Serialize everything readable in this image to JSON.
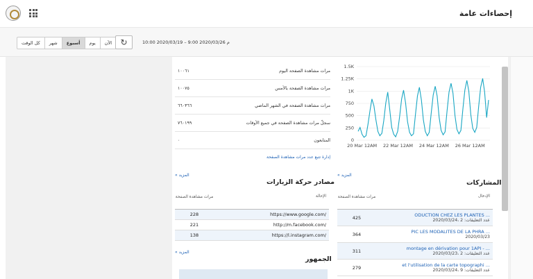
{
  "header": {
    "title": "إحصاءات عامة",
    "logo_icon": "site-logo-icon",
    "apps_icon": "apps-grid-icon"
  },
  "toolbar": {
    "ranges": [
      "كل الوقت",
      "شهر",
      "أسبوع",
      "يوم",
      "الآن"
    ],
    "active_range": "أسبوع",
    "refresh_icon": "refresh-icon",
    "date_range": "10:00 2020/03/19 – 9:00 2020/03/26 م"
  },
  "stats": {
    "rows": [
      {
        "label": "مرات مشاهدة الصفحة اليوم",
        "value": "١٠٠٦١"
      },
      {
        "label": "مرات مشاهدة الصفحة بالأمس",
        "value": "١٠٠٧٥"
      },
      {
        "label": "مرات مشاهدة الصفحة في الشهر الماضي",
        "value": "٦٦٠٣٦٦"
      },
      {
        "label": "سجلّ مرات مشاهدة الصفحة في جميع الأوقات",
        "value": "٧٦٠١٩٩"
      },
      {
        "label": "المتابعون",
        "value": "٠"
      }
    ],
    "link": "إدارة تتبع عدد مرات مشاهدة الصفحة"
  },
  "chart_data": {
    "type": "line",
    "title": "",
    "x": [
      "20 Mar 12AM",
      "22 Mar 12AM",
      "24 Mar 12AM",
      "26 Mar 12AM"
    ],
    "ylim": [
      0,
      1500
    ],
    "yticks": [
      "0",
      "250",
      "500",
      "750",
      "1K",
      "1.25K",
      "1.5K"
    ],
    "series": [
      {
        "values": [
          180,
          260,
          120,
          60,
          90,
          320,
          600,
          840,
          700,
          420,
          180,
          90,
          140,
          400,
          760,
          980,
          620,
          260,
          120,
          70,
          180,
          480,
          840,
          1020,
          760,
          380,
          160,
          90,
          130,
          520,
          900,
          1080,
          820,
          420,
          180,
          90,
          160,
          560,
          920,
          1100,
          900,
          460,
          200,
          110,
          170,
          600,
          980,
          1160,
          960,
          500,
          220,
          130,
          200,
          640,
          1020,
          1220,
          1000,
          520,
          240,
          160,
          260,
          700,
          1080,
          1260,
          980,
          460,
          820
        ]
      }
    ],
    "color": "#18a6c3"
  },
  "links": {
    "more": "المزيد »"
  },
  "traffic": {
    "title": "مصادر حركة الزيارات",
    "col_source": "الإحالة",
    "col_views": "مرات مشاهدة الصفحة",
    "rows": [
      {
        "source": "https://www.google.com/",
        "views": "228"
      },
      {
        "source": "http://m.facebook.com/",
        "views": "221"
      },
      {
        "source": "https://l.instagram.com/",
        "views": "138"
      }
    ]
  },
  "posts": {
    "title": "المشاركات",
    "col_entry": "الإدخال",
    "col_views": "مرات مشاهدة الصفحة",
    "rows": [
      {
        "title": "ODUCTION CHEZ LES PLANTES ...",
        "meta": "2020/03/24، عدد التعليقات: 2",
        "views": "425"
      },
      {
        "title": "PIC LES MODALITES DE LA PHRA ...",
        "meta": "2020/03/23",
        "views": "364"
      },
      {
        "title": "montage en dérivation pour 1API - ...",
        "meta": "2020/03/23، عدد التعليقات: 2",
        "views": "311"
      },
      {
        "title": "et l'utilisation de la carte topographi ...",
        "meta": "2020/03/24، عدد التعليقات: 9",
        "views": "279"
      }
    ]
  },
  "audience": {
    "title": "الجمهور"
  }
}
